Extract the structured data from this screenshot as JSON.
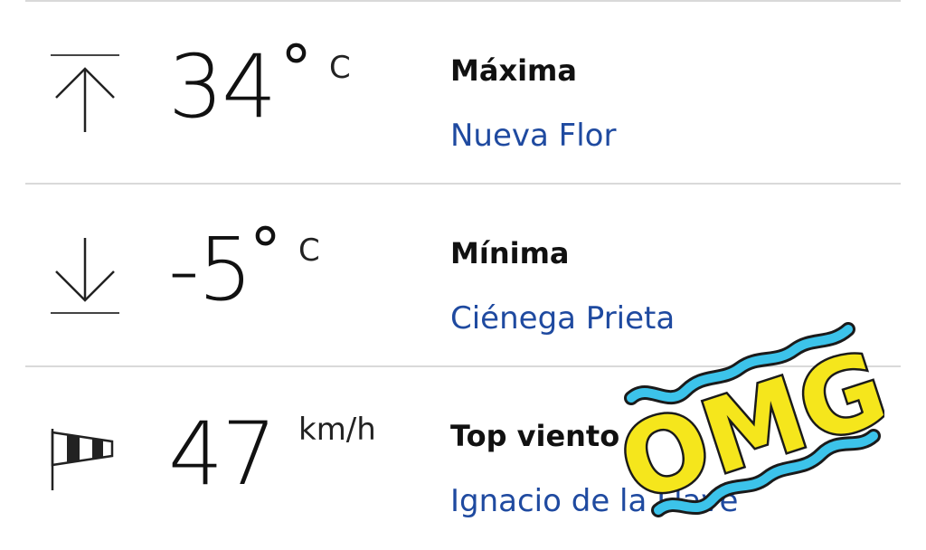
{
  "rows": [
    {
      "value": "34",
      "unit": "C",
      "label": "Máxima",
      "place": "Nueva Flor",
      "icon": "arrow-up-to-line-icon"
    },
    {
      "value": "-5",
      "unit": "C",
      "label": "Mínima",
      "place": "Ciénega Prieta",
      "icon": "arrow-down-to-line-icon"
    },
    {
      "value": "47",
      "unit": "km/h",
      "label": "Top viento",
      "place": "Ignacio de la Llave",
      "icon": "windsock-icon"
    }
  ],
  "sticker": {
    "text": "OMG",
    "fill_color": "#f5e61c",
    "wave_color": "#3cc3ea"
  },
  "colors": {
    "place_link": "#1f4aa0",
    "text": "#111111",
    "divider": "#d9d9d9"
  }
}
